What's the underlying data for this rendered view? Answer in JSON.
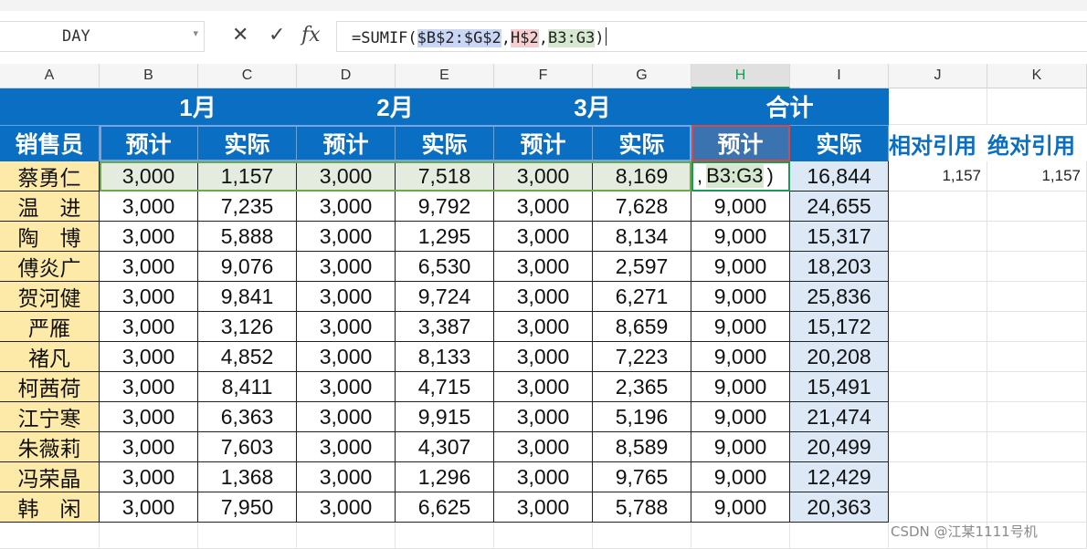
{
  "namebox": {
    "value": "DAY"
  },
  "formula": {
    "prefix": "=SUMIF(",
    "arg1": "$B$2:$G$2",
    "comma1": ",",
    "arg2": "H$2",
    "comma2": ",",
    "arg3": "B3:G3",
    "suffix": ")"
  },
  "columns": [
    "A",
    "B",
    "C",
    "D",
    "E",
    "F",
    "G",
    "H",
    "I",
    "J",
    "K"
  ],
  "selected_column": "H",
  "header": {
    "months": [
      "1月",
      "2月",
      "3月",
      "合计"
    ],
    "row2": [
      "销售员",
      "预计",
      "实际",
      "预计",
      "实际",
      "预计",
      "实际",
      "预计",
      "实际"
    ],
    "extra": [
      "相对引用",
      "绝对引用"
    ]
  },
  "editing_cell": {
    "text1": ",",
    "text2": "B3:G3",
    "text3": ")"
  },
  "rows": [
    {
      "name": "蔡勇仁",
      "vals": [
        "3,000",
        "1,157",
        "3,000",
        "7,518",
        "3,000",
        "8,169",
        "",
        "16,844"
      ]
    },
    {
      "name": "温　进",
      "vals": [
        "3,000",
        "7,235",
        "3,000",
        "9,792",
        "3,000",
        "7,628",
        "9,000",
        "24,655"
      ]
    },
    {
      "name": "陶　博",
      "vals": [
        "3,000",
        "5,888",
        "3,000",
        "1,295",
        "3,000",
        "8,134",
        "9,000",
        "15,317"
      ]
    },
    {
      "name": "傅炎广",
      "vals": [
        "3,000",
        "9,076",
        "3,000",
        "6,530",
        "3,000",
        "2,597",
        "9,000",
        "18,203"
      ]
    },
    {
      "name": "贺河健",
      "vals": [
        "3,000",
        "9,841",
        "3,000",
        "9,724",
        "3,000",
        "6,271",
        "9,000",
        "25,836"
      ]
    },
    {
      "name": "严雁",
      "vals": [
        "3,000",
        "3,126",
        "3,000",
        "3,387",
        "3,000",
        "8,659",
        "9,000",
        "15,172"
      ]
    },
    {
      "name": "褚凡",
      "vals": [
        "3,000",
        "4,852",
        "3,000",
        "8,133",
        "3,000",
        "7,223",
        "9,000",
        "20,208"
      ]
    },
    {
      "name": "柯茜荷",
      "vals": [
        "3,000",
        "8,411",
        "3,000",
        "4,715",
        "3,000",
        "2,365",
        "9,000",
        "15,491"
      ]
    },
    {
      "name": "江宁寒",
      "vals": [
        "3,000",
        "6,363",
        "3,000",
        "9,915",
        "3,000",
        "5,196",
        "9,000",
        "21,474"
      ]
    },
    {
      "name": "朱薇莉",
      "vals": [
        "3,000",
        "7,603",
        "3,000",
        "4,307",
        "3,000",
        "8,589",
        "9,000",
        "20,499"
      ]
    },
    {
      "name": "冯荣晶",
      "vals": [
        "3,000",
        "1,368",
        "3,000",
        "1,296",
        "3,000",
        "9,765",
        "9,000",
        "12,429"
      ]
    },
    {
      "name": "韩　闲",
      "vals": [
        "3,000",
        "7,950",
        "3,000",
        "6,625",
        "3,000",
        "5,788",
        "9,000",
        "20,363"
      ]
    }
  ],
  "row3_extra": [
    "1,157",
    "1,157"
  ],
  "watermark": "CSDN @江某1111号机"
}
